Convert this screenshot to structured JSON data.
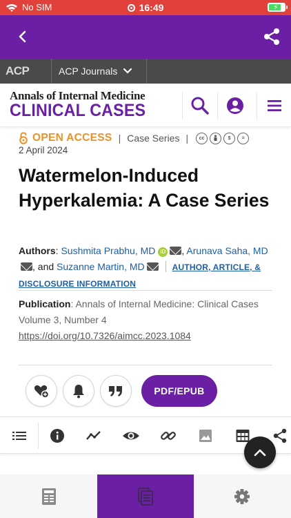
{
  "status_bar": {
    "carrier": "No SIM",
    "time": "16:49",
    "battery_percent": 80
  },
  "acp": {
    "logo": "ACP",
    "journals_label": "ACP Journals"
  },
  "journal": {
    "name_top": "Annals of Internal Medicine",
    "name_bottom": "CLINICAL CASES"
  },
  "article": {
    "access": "OPEN ACCESS",
    "content_type": "Case Series",
    "date": "2 April 2024",
    "title": "Watermelon-Induced Hyperkalemia: A Case Series",
    "authors_label": "Authors",
    "authors": [
      "Sushmita Prabhu, MD",
      "Arunava Saha, MD",
      "Suzanne Martin, MD"
    ],
    "and": "and",
    "disclosure": "AUTHOR, ARTICLE, & DISCLOSURE INFORMATION",
    "publication_label": "Publication",
    "publication": "Annals of Internal Medicine: Clinical Cases",
    "volume": "Volume 3, Number 4",
    "doi": "https://doi.org/10.7326/aimcc.2023.1084"
  },
  "actions": {
    "pdf_label": "PDF/EPUB"
  },
  "colors": {
    "brand_purple": "#6a1fa5",
    "status_red": "#e2403b",
    "open_access_orange": "#e8922a",
    "link_blue": "#1b5fa8"
  },
  "icons": {
    "topbar": [
      "back-icon",
      "share-icon"
    ],
    "header": [
      "search-icon",
      "account-icon",
      "menu-icon"
    ],
    "actions": [
      "favorite-add-icon",
      "bell-icon",
      "quote-icon"
    ],
    "toolbar": [
      "list-icon",
      "info-icon",
      "metrics-icon",
      "eye-icon",
      "link-icon",
      "image-icon",
      "table-icon",
      "share-icon"
    ],
    "bottom_nav": [
      "issue-icon",
      "articles-icon",
      "settings-icon"
    ]
  }
}
